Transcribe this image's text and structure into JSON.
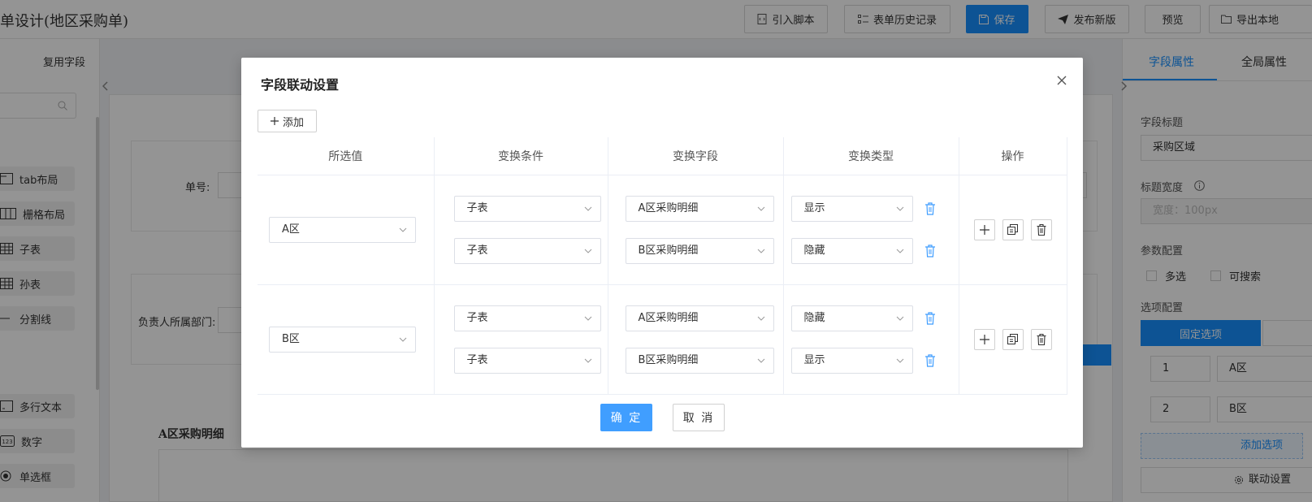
{
  "app": {
    "title": "单设计(地区采购单)"
  },
  "toolbar": {
    "import_script": "引入脚本",
    "history": "表单历史记录",
    "save": "保存",
    "publish": "发布新版",
    "preview": "预览",
    "export": "导出本地"
  },
  "left_panel": {
    "tab_reuse": "复用字段",
    "components": [
      {
        "label": "tab布局",
        "icon": "tab-layout-icon"
      },
      {
        "label": "栅格布局",
        "icon": "grid-layout-icon"
      },
      {
        "label": "子表",
        "icon": "table-icon"
      },
      {
        "label": "孙表",
        "icon": "table-icon"
      },
      {
        "label": "分割线",
        "icon": "divider-icon"
      },
      {
        "label": "多行文本",
        "icon": "textarea-icon"
      },
      {
        "label": "数字",
        "icon": "number-icon"
      },
      {
        "label": "单选框",
        "icon": "radio-icon"
      }
    ]
  },
  "canvas": {
    "order_no_label": "单号:",
    "dept_label": "负责人所属部门:",
    "section_a_title": "A区采购明细"
  },
  "right_panel": {
    "tab_field": "字段属性",
    "tab_global": "全局属性",
    "field_title_label": "字段标题",
    "field_title_value": "采购区域",
    "title_width_label": "标题宽度",
    "title_width_placeholder": "宽度：100px",
    "param_label": "参数配置",
    "multi_label": "多选",
    "search_label": "可搜索",
    "options_label": "选项配置",
    "fixed_options": "固定选项",
    "options": [
      {
        "value": "1",
        "label": "A区"
      },
      {
        "value": "2",
        "label": "B区"
      }
    ],
    "add_option": "添加选项",
    "linkage": "联动设置"
  },
  "modal": {
    "title": "字段联动设置",
    "add_label": "添加",
    "headers": [
      "所选值",
      "变换条件",
      "变换字段",
      "变换类型",
      "操作"
    ],
    "rows": [
      {
        "value": "A区",
        "rules": [
          {
            "condition": "子表",
            "field": "A区采购明细",
            "type": "显示"
          },
          {
            "condition": "子表",
            "field": "B区采购明细",
            "type": "隐藏"
          }
        ]
      },
      {
        "value": "B区",
        "rules": [
          {
            "condition": "子表",
            "field": "A区采购明细",
            "type": "隐藏"
          },
          {
            "condition": "子表",
            "field": "B区采购明细",
            "type": "显示"
          }
        ]
      }
    ],
    "ok": "确 定",
    "cancel": "取 消"
  },
  "colors": {
    "primary": "#1890ff",
    "ok_button": "#409eff",
    "mask": "rgba(0,0,0,0.42)"
  }
}
